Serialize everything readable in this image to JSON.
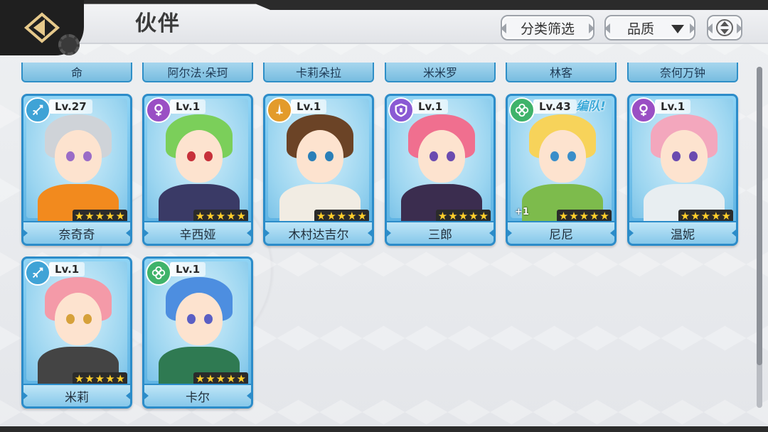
{
  "header": {
    "title": "伙伴",
    "filter_label": "分类筛选",
    "quality_label": "品质"
  },
  "partial_row": [
    "命",
    "阿尔法·朵珂",
    "卡莉朵拉",
    "米米罗",
    "林客",
    "奈何万钟"
  ],
  "heroes": [
    {
      "name": "奈奇奇",
      "level": "Lv.27",
      "class_icon": "bow-icon",
      "stars": 5,
      "hair": "#cfd3d8",
      "eyes": "#9a6cc7",
      "outfit": "#f28a1e",
      "badge": "#3fa3d6"
    },
    {
      "name": "辛西娅",
      "level": "Lv.1",
      "class_icon": "venus-icon",
      "stars": 5,
      "hair": "#7bcf5a",
      "eyes": "#c7303a",
      "outfit": "#3a3a66",
      "badge": "#9a4fc4"
    },
    {
      "name": "木村达吉尔",
      "level": "Lv.1",
      "class_icon": "sword-icon",
      "stars": 5,
      "hair": "#6b4326",
      "eyes": "#2a7fb8",
      "outfit": "#f1ece3",
      "badge": "#e39b2b"
    },
    {
      "name": "三郎",
      "level": "Lv.1",
      "class_icon": "shield-icon",
      "stars": 5,
      "hair": "#f06f8f",
      "eyes": "#6a4bb0",
      "outfit": "#3b2d4f",
      "badge": "#8a5ad4"
    },
    {
      "name": "尼尼",
      "level": "Lv.43",
      "class_icon": "clover-icon",
      "stars": 5,
      "hair": "#f7d35a",
      "eyes": "#3a8ec9",
      "outfit": "#7dbb4c",
      "badge": "#3fb36a",
      "team_tag": "编队!",
      "bonus": "+1"
    },
    {
      "name": "温妮",
      "level": "Lv.1",
      "class_icon": "venus-icon",
      "stars": 5,
      "hair": "#f3a7bd",
      "eyes": "#6a4bb0",
      "outfit": "#e8eef1",
      "badge": "#9a4fc4"
    },
    {
      "name": "米莉",
      "level": "Lv.1",
      "class_icon": "bow-icon",
      "stars": 5,
      "hair": "#f49aa8",
      "eyes": "#d6a13a",
      "outfit": "#444",
      "badge": "#3fa3d6"
    },
    {
      "name": "卡尔",
      "level": "Lv.1",
      "class_icon": "clover-icon",
      "stars": 5,
      "hair": "#4d8ee0",
      "eyes": "#5a5fc4",
      "outfit": "#2f7a52",
      "badge": "#3fb36a"
    }
  ]
}
